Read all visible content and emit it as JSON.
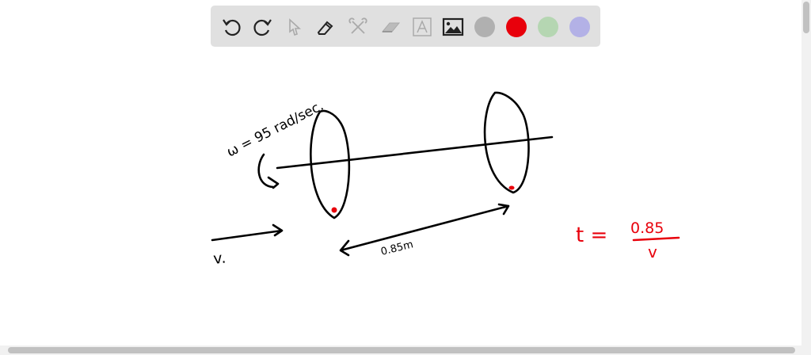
{
  "toolbar": {
    "tools": [
      "undo-icon",
      "redo-icon",
      "select-icon",
      "pen-icon",
      "tools-icon",
      "eraser-icon",
      "text-icon",
      "image-icon"
    ],
    "colors": [
      "#b0b0b0",
      "#e8000b",
      "#b5d6b2",
      "#b3b1e6"
    ]
  },
  "drawing": {
    "omega_label": "ω = 95 rad/sec.",
    "distance_label": "0.85m",
    "velocity_label": "v.",
    "time_var": "t =",
    "time_numerator": "0.85",
    "time_denominator": "v"
  }
}
